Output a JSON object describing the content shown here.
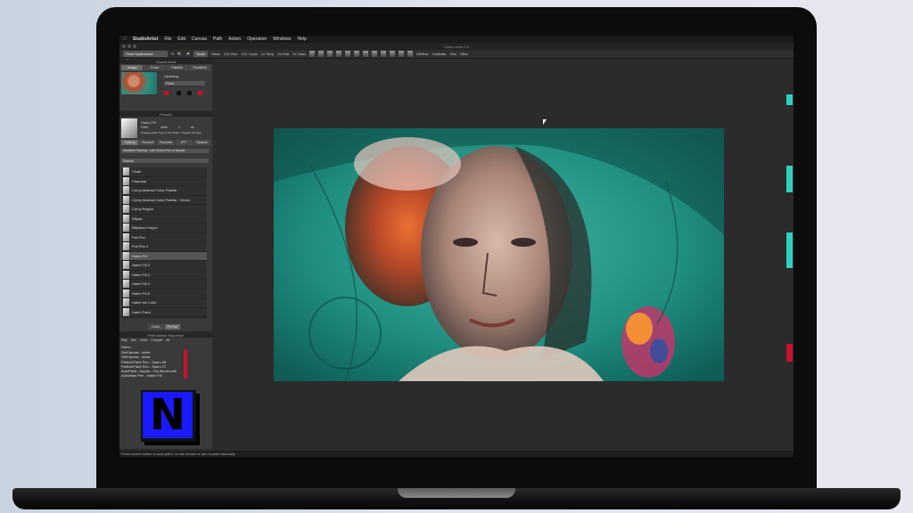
{
  "menu": [
    "StudioArtist",
    "File",
    "Edit",
    "Canvas",
    "Path",
    "Action",
    "Operation",
    "Windows",
    "Help"
  ],
  "window_title": "Studio Artist 5.5",
  "toolbar": {
    "preset": "Paint Synthesizer Classic",
    "zoom_value": "Scale",
    "buttons": [
      "Mask",
      "1X1 Run",
      "1X1 Cycle",
      "1X Step",
      "1X Edit",
      "1X Grab"
    ],
    "right_labels": [
      "HDRise",
      "Oddballs",
      "20m",
      "Wkiz"
    ]
  },
  "source_panel": {
    "title": "Source Area",
    "tabs": [
      "Image",
      "Color",
      "Palette",
      "Gradient"
    ],
    "label": "Updating",
    "dropdown": "Paint"
  },
  "presets_panel": {
    "title": "Presets",
    "brush_name": "Hatch Fill",
    "paint_label": "Paint",
    "paint_values": [
      "white",
      "1",
      "sit"
    ],
    "desc": "Change Hatch Type in the Slider > Region Fill Type",
    "tabs": [
      "Gallery",
      "Recent",
      "Favorite",
      "IPT",
      "Search"
    ],
    "mode": "Assisted Painting - Use Action Pen or Mouse",
    "category": "Sketch",
    "filter_tabs": [
      "Color",
      "Preset"
    ],
    "brushes": [
      "Chalk",
      "Charcoal",
      "Curvy Abstract Color Palette",
      "Curvy Abstract Color Palette - Vector",
      "Curvy Region",
      "Ellipse",
      "Elliptical Crayon",
      "Felt Pen",
      "Felt Pen 2",
      "Hatch Fill",
      "Hatch Fill 2",
      "Hatch Fill 3",
      "Hatch Fill 4",
      "Hatch Fill 5",
      "Hatch Ink Color",
      "Hatch Paint"
    ],
    "selected_index": 9
  },
  "sequence_panel": {
    "title": "Paint Action Sequence",
    "tools": [
      "Play",
      "Rec",
      "Undo",
      "Compile",
      "All"
    ],
    "header": "Name",
    "items": [
      "SetCanvas - white",
      "SetCanvas - black",
      "ParticlePaint Pen - Sparc 08",
      "ParticlePaint Pen - Sparc 07",
      "AutoPaint - Acrylic - Dry Brush with",
      "Autodraw Pen - Hatch Fill"
    ]
  },
  "logo_letter": "N",
  "status": "Press Action button to auto paint, or use mouse or pen to paint manually"
}
